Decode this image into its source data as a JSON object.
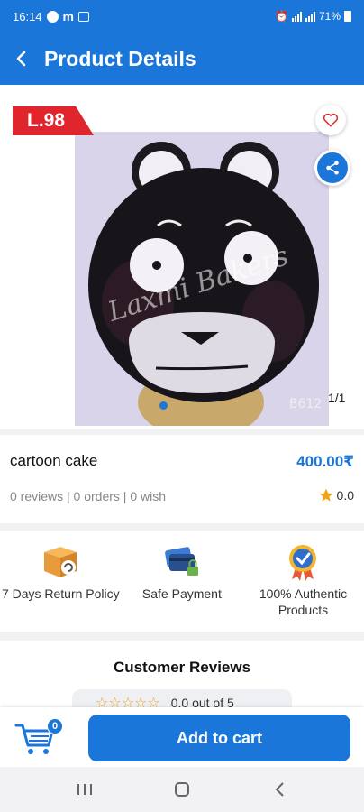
{
  "status_bar": {
    "time": "16:14",
    "battery": "71%"
  },
  "header": {
    "title": "Product Details",
    "back_icon": "back-arrow-icon"
  },
  "product": {
    "price_tag": "L.98",
    "image_counter": "1/1",
    "image_watermark": "Laxmi Bakers",
    "image_code": "B612",
    "name": "cartoon cake",
    "price": "400.00₹",
    "stats": "0 reviews | 0 orders | 0 wish",
    "rating": "0.0"
  },
  "features": [
    {
      "label": "7 Days Return Policy",
      "icon": "return-box-icon"
    },
    {
      "label": "Safe Payment",
      "icon": "payment-cards-icon"
    },
    {
      "label": "100% Authentic Products",
      "icon": "authentic-badge-icon"
    }
  ],
  "reviews": {
    "title": "Customer Reviews",
    "summary": "0.0 out of 5",
    "stars": "☆☆☆☆☆"
  },
  "cart": {
    "count": "0",
    "add_label": "Add to cart"
  },
  "colors": {
    "primary": "#1a76d8",
    "price_tag": "#e0262c",
    "star": "#f0a21b"
  }
}
